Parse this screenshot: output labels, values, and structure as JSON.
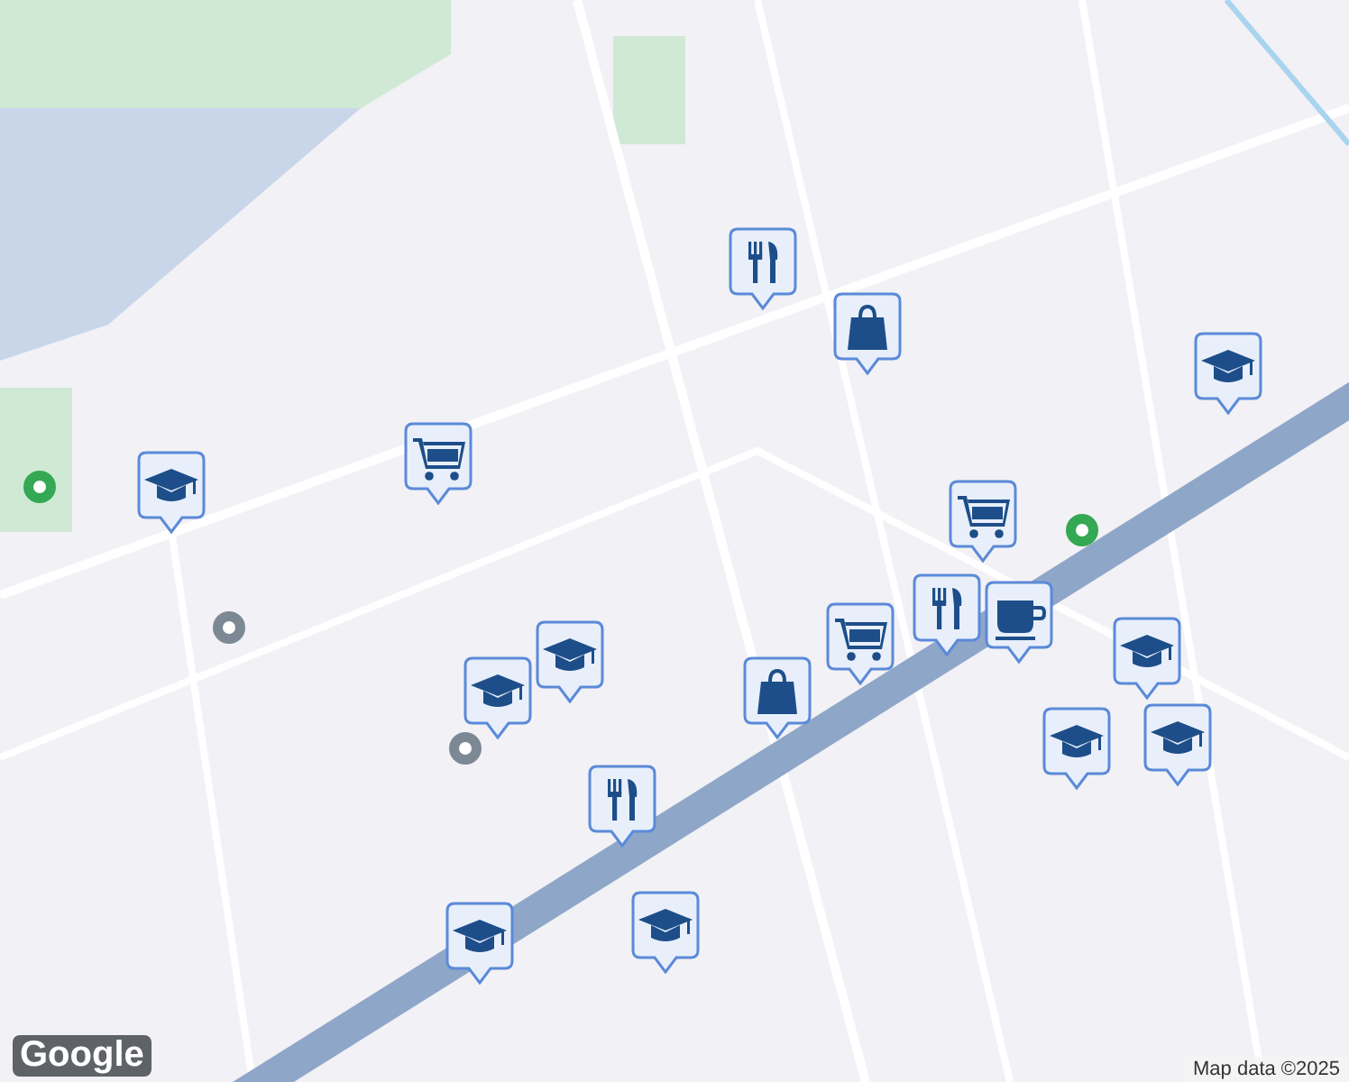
{
  "markers": [
    {
      "kind": "restaurant"
    },
    {
      "kind": "bag"
    },
    {
      "kind": "school"
    },
    {
      "kind": "cart"
    },
    {
      "kind": "school"
    },
    {
      "kind": "cart"
    },
    {
      "kind": "restaurant"
    },
    {
      "kind": "coffee"
    },
    {
      "kind": "cart"
    },
    {
      "kind": "school"
    },
    {
      "kind": "school"
    },
    {
      "kind": "bag"
    },
    {
      "kind": "school"
    },
    {
      "kind": "school"
    },
    {
      "kind": "school"
    },
    {
      "kind": "restaurant"
    },
    {
      "kind": "school"
    },
    {
      "kind": "school"
    }
  ],
  "logo": "Google",
  "attribution": "Map data ©2025"
}
